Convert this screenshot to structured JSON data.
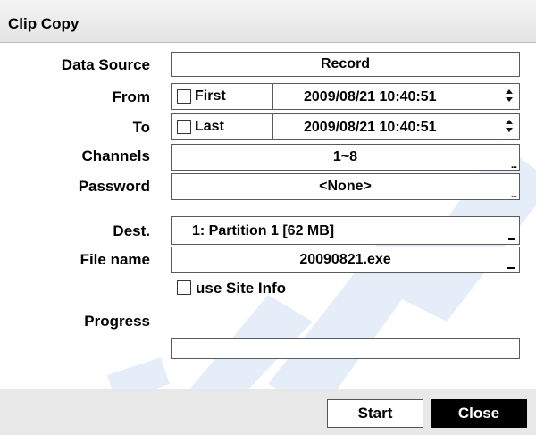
{
  "dialog": {
    "title": "Clip Copy"
  },
  "labels": {
    "data_source": "Data Source",
    "from": "From",
    "to": "To",
    "channels": "Channels",
    "password": "Password",
    "dest": "Dest.",
    "file_name": "File name",
    "progress": "Progress"
  },
  "fields": {
    "data_source": "Record",
    "from_check_label": "First",
    "from_datetime": "2009/08/21  10:40:51",
    "to_check_label": "Last",
    "to_datetime": "2009/08/21  10:40:51",
    "channels": "1~8",
    "password": "<None>",
    "dest": "1: Partition 1 [62 MB]",
    "file_name": "20090821.exe",
    "use_site_info_label": "use Site Info"
  },
  "state": {
    "from_first_checked": false,
    "to_last_checked": false,
    "use_site_info_checked": false,
    "progress_fraction": 0
  },
  "buttons": {
    "start": "Start",
    "close": "Close"
  },
  "colors": {
    "watermark": "#cfe0f3",
    "close_bg": "#000000",
    "close_text": "#ffffff"
  },
  "icons": {
    "more": "ellipsis-icon",
    "dropdown": "dropdown-indicator-icon",
    "edit": "edit-indicator-icon",
    "spin": "spinner-arrows-icon"
  }
}
